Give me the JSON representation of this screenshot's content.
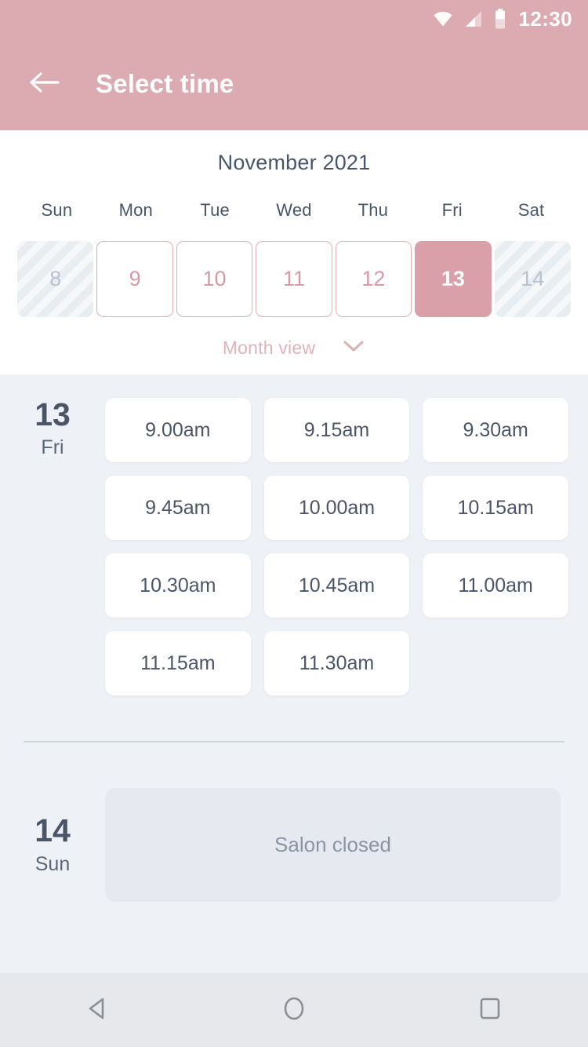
{
  "status_bar": {
    "time": "12:30",
    "icons": [
      "wifi-icon",
      "cellular-signal-icon",
      "battery-icon"
    ]
  },
  "app_bar": {
    "back_icon": "back-arrow-icon",
    "title": "Select time"
  },
  "calendar": {
    "month_title": "November 2021",
    "weekdays": [
      "Sun",
      "Mon",
      "Tue",
      "Wed",
      "Thu",
      "Fri",
      "Sat"
    ],
    "days": [
      {
        "number": "8",
        "state": "disabled"
      },
      {
        "number": "9",
        "state": "available"
      },
      {
        "number": "10",
        "state": "available"
      },
      {
        "number": "11",
        "state": "available"
      },
      {
        "number": "12",
        "state": "available"
      },
      {
        "number": "13",
        "state": "selected"
      },
      {
        "number": "14",
        "state": "disabled"
      }
    ],
    "month_view_label": "Month view",
    "month_view_icon": "chevron-down-icon"
  },
  "schedule": [
    {
      "day_number": "13",
      "day_name": "Fri",
      "slots": [
        "9.00am",
        "9.15am",
        "9.30am",
        "9.45am",
        "10.00am",
        "10.15am",
        "10.30am",
        "10.45am",
        "11.00am",
        "11.15am",
        "11.30am"
      ]
    },
    {
      "day_number": "14",
      "day_name": "Sun",
      "closed_message": "Salon closed"
    }
  ],
  "nav_bar": {
    "back": "nav-back-icon",
    "home": "nav-home-icon",
    "recents": "nav-recents-icon"
  },
  "colors": {
    "header_pink": "#dcabb2",
    "accent_pink": "#d9a0aa",
    "border_pink": "#deafb6",
    "content_bg": "#eef1f6",
    "text_slate": "#4a5568",
    "disabled_bg": "#e8edf2",
    "closed_card": "#e6eaf0"
  }
}
